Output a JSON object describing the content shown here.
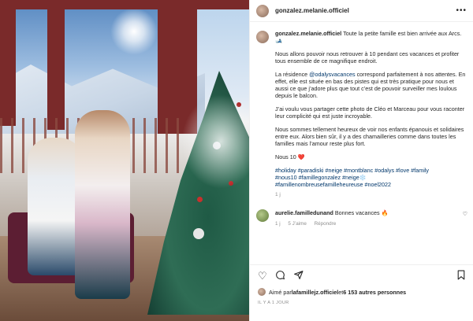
{
  "post": {
    "username": "gonzalez.melanie.officiel",
    "caption_first": "Toute la petite famille est bien arrivée aux Arcs.",
    "caption_emoji": "🎿",
    "paragraph2": "Nous allons pouvoir nous retrouver à 10 pendant ces vacances et profiter tous ensemble de ce magnifique endroit.",
    "paragraph3_pre": "La résidence ",
    "paragraph3_mention": "@odalysvacances",
    "paragraph3_post": " correspond parfaitement à nos attentes. En effet, elle est située en bas des pistes qui est très pratique pour nous et aussi ce que j’adore plus que tout c’est de pouvoir surveiller mes loulous depuis le balcon.",
    "paragraph4": "J’ai voulu vous partager cette photo de Cléo et Marceau pour vous raconter leur complicité qui est juste incroyable.",
    "paragraph5": "Nous sommes tellement heureux de voir nos enfants épanouis et solidaires entre eux. Alors bien sûr, il y a des chamailleries comme dans toutes les familles mais l’amour reste plus fort.",
    "paragraph6": "Nous 10",
    "paragraph6_emoji": "❤️",
    "hashtags_line1": "#holiday #paradiski #neige #montblanc #odalys #love #family",
    "hashtags_line2": "#nous10 #famillegonzalez #neige",
    "hashtags_line2_emoji": "❄️",
    "hashtags_line3": "#famillenombreusefamilleheureuse #noel2022",
    "time": "1 j"
  },
  "comment": {
    "username": "aurelie.familledunand",
    "text": "Bonnes vacances",
    "emoji": "🔥",
    "time": "1 j",
    "likes": "5 J’aime",
    "reply": "Répondre"
  },
  "actions": {
    "like_icon": "heart-icon",
    "comment_icon": "comment-icon",
    "share_icon": "share-icon",
    "save_icon": "bookmark-icon"
  },
  "likes": {
    "prefix": "Aimé par ",
    "user": "lafamillejz.officiel",
    "middle": " et ",
    "others": "6 153 autres personnes"
  },
  "ago": "IL Y A 1 JOUR"
}
